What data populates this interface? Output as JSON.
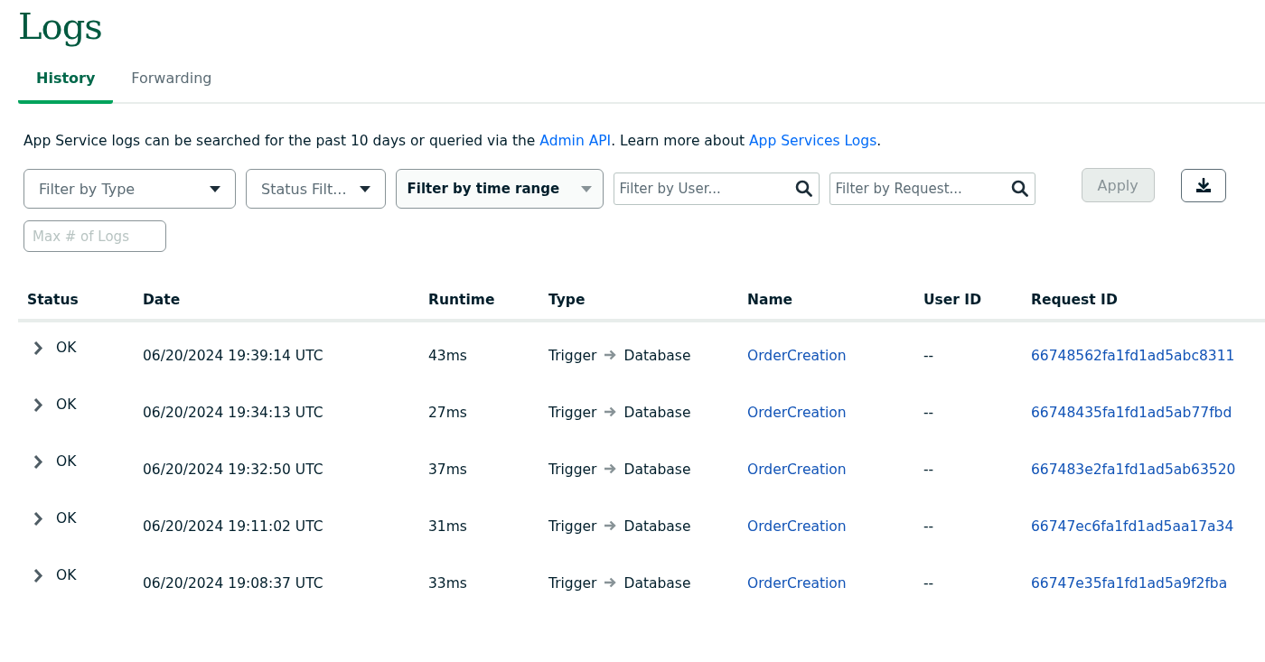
{
  "page": {
    "title": "Logs"
  },
  "tabs": [
    {
      "label": "History",
      "selected": true
    },
    {
      "label": "Forwarding",
      "selected": false
    }
  ],
  "description": [
    {
      "kind": "text",
      "text": "App Service logs can be searched for the past 10 days or queried via the "
    },
    {
      "kind": "link",
      "text": "Admin API"
    },
    {
      "kind": "text",
      "text": ". Learn more about "
    },
    {
      "kind": "link",
      "text": "App Services Logs"
    },
    {
      "kind": "text",
      "text": "."
    }
  ],
  "filters": [
    {
      "kind": "select",
      "label": "Filter by Type",
      "active": false
    },
    {
      "kind": "select",
      "label": "Status Filt...",
      "active": false
    },
    {
      "kind": "select",
      "label": "Filter by time range",
      "active": true
    },
    {
      "kind": "search",
      "placeholder": "Filter by User..."
    },
    {
      "kind": "search",
      "placeholder": "Filter by Request..."
    }
  ],
  "apply_button": {
    "label": "Apply",
    "disabled": true
  },
  "max_logs": {
    "placeholder": "Max # of Logs"
  },
  "table": {
    "columns": [
      "Status",
      "Date",
      "Runtime",
      "Type",
      "Name",
      "User ID",
      "Request ID"
    ],
    "rows": [
      {
        "expanded": false,
        "status": "OK",
        "date": "06/20/2024 19:39:14 UTC",
        "runtime": "43ms",
        "type_from": "Trigger",
        "type_to": "Database",
        "name": "OrderCreation",
        "user_id": "--",
        "request_id": "66748562fa1fd1ad5abc8311"
      },
      {
        "expanded": false,
        "status": "OK",
        "date": "06/20/2024 19:34:13 UTC",
        "runtime": "27ms",
        "type_from": "Trigger",
        "type_to": "Database",
        "name": "OrderCreation",
        "user_id": "--",
        "request_id": "66748435fa1fd1ad5ab77fbd"
      },
      {
        "expanded": false,
        "status": "OK",
        "date": "06/20/2024 19:32:50 UTC",
        "runtime": "37ms",
        "type_from": "Trigger",
        "type_to": "Database",
        "name": "OrderCreation",
        "user_id": "--",
        "request_id": "667483e2fa1fd1ad5ab63520"
      },
      {
        "expanded": false,
        "status": "OK",
        "date": "06/20/2024 19:11:02 UTC",
        "runtime": "31ms",
        "type_from": "Trigger",
        "type_to": "Database",
        "name": "OrderCreation",
        "user_id": "--",
        "request_id": "66747ec6fa1fd1ad5aa17a34"
      },
      {
        "expanded": false,
        "status": "OK",
        "date": "06/20/2024 19:08:37 UTC",
        "runtime": "33ms",
        "type_from": "Trigger",
        "type_to": "Database",
        "name": "OrderCreation",
        "user_id": "--",
        "request_id": "66747e35fa1fd1ad5a9f2fba"
      }
    ]
  }
}
